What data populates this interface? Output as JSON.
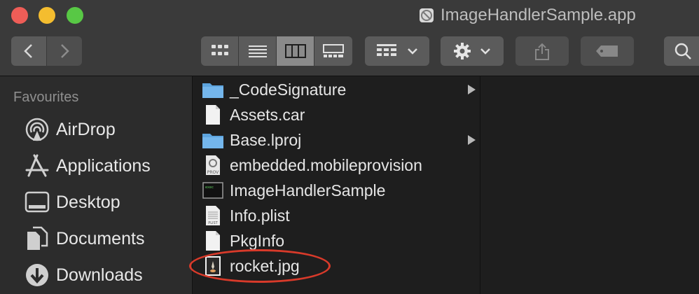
{
  "window": {
    "title": "ImageHandlerSample.app",
    "title_icon": "app-bundle-icon"
  },
  "toolbar": {
    "back_icon": "chevron-left-icon",
    "forward_icon": "chevron-right-icon",
    "view_modes": [
      "icon-view",
      "list-view",
      "column-view",
      "gallery-view"
    ],
    "active_view": "column-view",
    "group_icon": "group-grid-icon",
    "action_icon": "gear-icon",
    "share_icon": "share-icon",
    "tag_icon": "tag-icon",
    "search_icon": "search-icon"
  },
  "sidebar": {
    "heading": "Favourites",
    "items": [
      {
        "label": "AirDrop",
        "icon": "airdrop-icon"
      },
      {
        "label": "Applications",
        "icon": "applications-icon"
      },
      {
        "label": "Desktop",
        "icon": "desktop-icon"
      },
      {
        "label": "Documents",
        "icon": "documents-icon"
      },
      {
        "label": "Downloads",
        "icon": "downloads-icon"
      }
    ]
  },
  "files": [
    {
      "name": "_CodeSignature",
      "icon": "folder-icon",
      "has_children": true
    },
    {
      "name": "Assets.car",
      "icon": "document-icon",
      "has_children": false
    },
    {
      "name": "Base.lproj",
      "icon": "folder-icon",
      "has_children": true
    },
    {
      "name": "embedded.mobileprovision",
      "icon": "provision-file-icon",
      "badge": "PROV",
      "has_children": false
    },
    {
      "name": "ImageHandlerSample",
      "icon": "executable-icon",
      "badge": "exec",
      "has_children": false
    },
    {
      "name": "Info.plist",
      "icon": "plist-file-icon",
      "badge": "PLIST",
      "has_children": false
    },
    {
      "name": "PkgInfo",
      "icon": "document-icon",
      "has_children": false
    },
    {
      "name": "rocket.jpg",
      "icon": "image-file-icon",
      "has_children": false
    }
  ],
  "annotation": {
    "target": "rocket.jpg",
    "color": "#d83a2a",
    "shape": "ellipse"
  },
  "colors": {
    "toolbar": "#3a3a3a",
    "sidebar": "#2c2c2c",
    "content": "#1e1e1e",
    "folder": "#6aaee6",
    "close": "#ee5d57",
    "minimize": "#f4bd2f",
    "maximize": "#58c845"
  }
}
